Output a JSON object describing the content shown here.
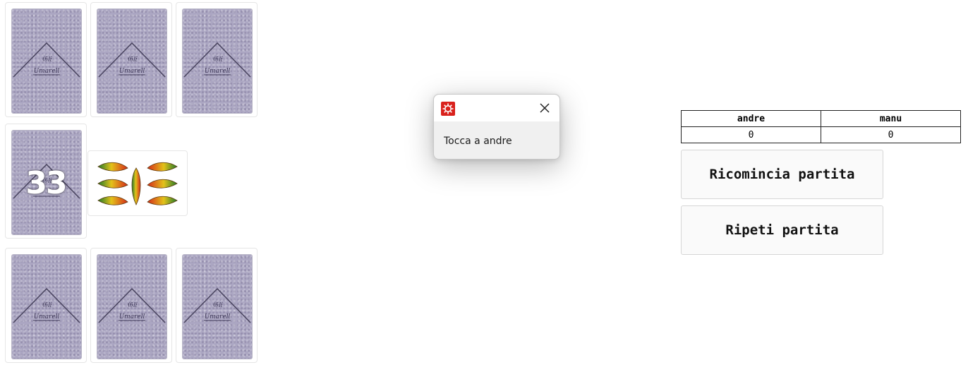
{
  "deck": {
    "remaining_count": "33"
  },
  "dialog": {
    "message": "Tocca a andre",
    "app_icon": "gear-app-icon",
    "close_icon": "close-icon"
  },
  "scoreboard": {
    "players": [
      "andre",
      "manu"
    ],
    "scores": [
      "0",
      "0"
    ]
  },
  "buttons": {
    "restart": "Ricomincia partita",
    "repeat": "Ripeti partita"
  },
  "card_back": {
    "logo_text": "Gli Umarell"
  },
  "colors": {
    "card_back": "#aba6c2",
    "dialog_icon": "#d9211c"
  }
}
